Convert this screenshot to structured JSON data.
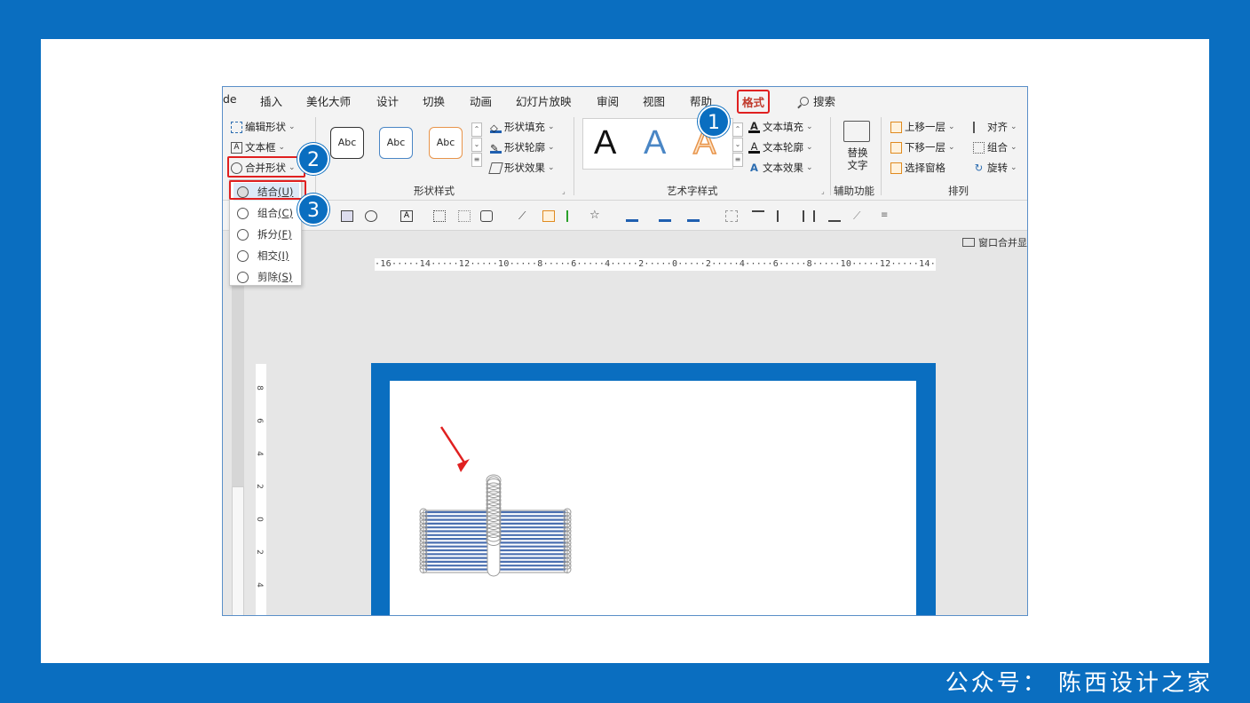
{
  "footer_text": "公众号： 陈西设计之家",
  "tabs": {
    "partial": "de",
    "insert": "插入",
    "beautify": "美化大师",
    "design": "设计",
    "transitions": "切换",
    "animations": "动画",
    "slideshow": "幻灯片放映",
    "review": "审阅",
    "view": "视图",
    "help": "帮助",
    "format": "格式",
    "search": "搜索"
  },
  "ribbon": {
    "edit_shape": "编辑形状",
    "text_box": "文本框",
    "merge_shapes": "合并形状",
    "abc": "Abc",
    "shape_fill": "形状填充",
    "shape_outline": "形状轮廓",
    "shape_effects": "形状效果",
    "shape_styles_label": "形状样式",
    "wordart_a": "A",
    "text_fill": "文本填充",
    "text_outline": "文本轮廓",
    "text_effects": "文本效果",
    "wordart_label": "艺术字样式",
    "alt_text_line1": "替换",
    "alt_text_line2": "文字",
    "accessibility_label": "辅助功能",
    "bring_forward": "上移一层",
    "send_backward": "下移一层",
    "selection_pane": "选择窗格",
    "align": "对齐",
    "group": "组合",
    "rotate": "旋转",
    "arrange_label": "排列"
  },
  "merge_window": "窗口合并显",
  "hruler_text": "·16·····14·····12·····10·····8·····6·····4·····2·····0·····2·····4·····6·····8·····10·····12·····14·····16·",
  "vruler_numbers": [
    "8",
    "6",
    "4",
    "2",
    "0",
    "2",
    "4"
  ],
  "dropdown": {
    "union": {
      "name": "结合",
      "key": "(U)"
    },
    "combine": {
      "name": "组合",
      "key": "(C)"
    },
    "fragment": {
      "name": "拆分",
      "key": "(F)"
    },
    "intersect": {
      "name": "相交",
      "key": "(I)"
    },
    "subtract": {
      "name": "剪除",
      "key": "(S)"
    }
  },
  "callouts": [
    "1",
    "2",
    "3"
  ],
  "colors": {
    "brand_blue": "#0a6ec0",
    "highlight_red": "#e02020",
    "shape_blue": "#4a6fb0",
    "outline_gray": "#9a9a9a"
  }
}
